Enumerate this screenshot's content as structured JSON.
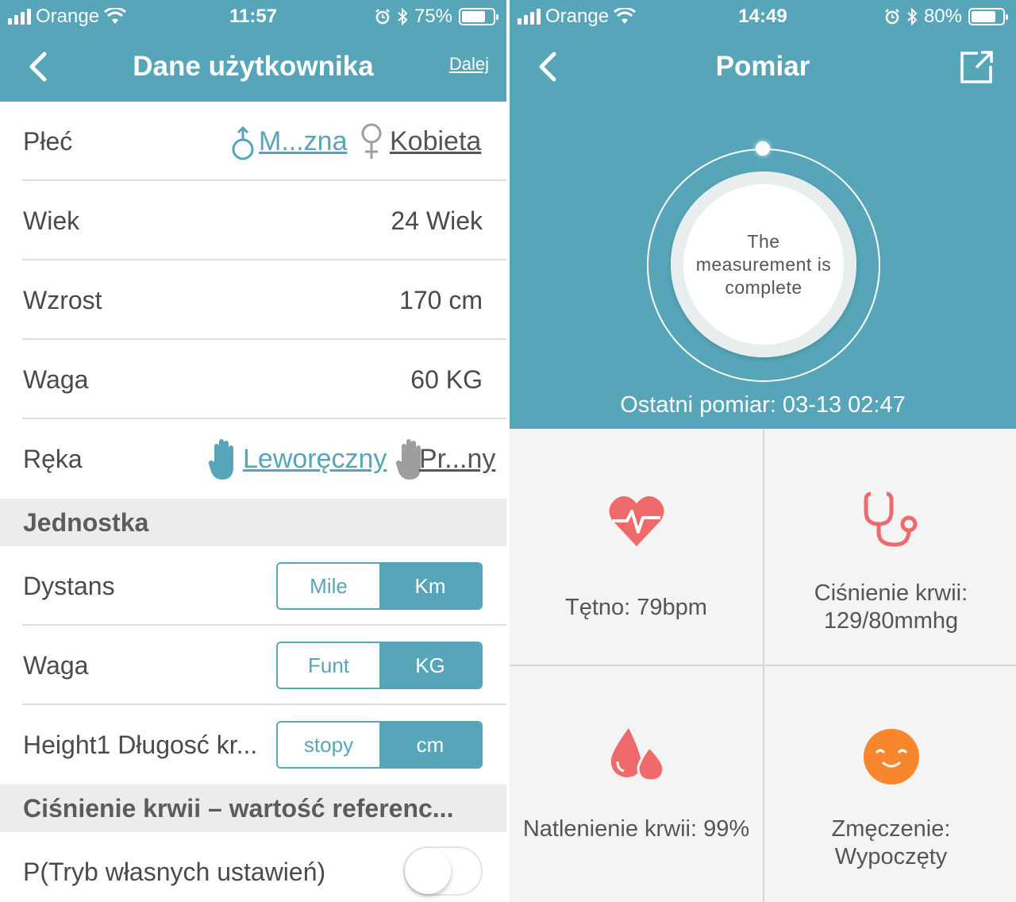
{
  "left": {
    "status": {
      "carrier": "Orange",
      "time": "11:57",
      "battery": "75%",
      "battery_level": 0.75
    },
    "header": {
      "title": "Dane użytkownika",
      "next": "Dalej"
    },
    "rows": {
      "gender": {
        "label": "Płeć",
        "male": "M...zna",
        "female": "Kobieta",
        "selected": "male"
      },
      "age": {
        "label": "Wiek",
        "value": "24 Wiek"
      },
      "height": {
        "label": "Wzrost",
        "value": "170 cm"
      },
      "weight": {
        "label": "Waga",
        "value": "60 KG"
      },
      "hand": {
        "label": "Ręka",
        "left": "Leworęczny",
        "right": "Pr...ny",
        "selected": "left"
      }
    },
    "units_section": "Jednostka",
    "units": [
      {
        "label": "Dystans",
        "opt_a": "Mile",
        "opt_b": "Km",
        "selected": "b"
      },
      {
        "label": "Waga",
        "opt_a": "Funt",
        "opt_b": "KG",
        "selected": "b"
      },
      {
        "label": "Height1 Długosć kr...",
        "opt_a": "stopy",
        "opt_b": "cm",
        "selected": "b"
      }
    ],
    "bp_section": "Ciśnienie krwii – wartość referenc...",
    "bp_row": {
      "label": "P(Tryb własnych ustawień)",
      "toggle_on": false
    },
    "colors": {
      "accent": "#56a5b8",
      "gray_icon": "#9e9e9e"
    }
  },
  "right": {
    "status": {
      "carrier": "Orange",
      "time": "14:49",
      "battery": "80%",
      "battery_level": 0.8
    },
    "header": {
      "title": "Pomiar"
    },
    "circle_text": "The measurement is complete",
    "last_measurement": "Ostatni pomiar: 03-13 02:47",
    "tiles": {
      "heart": {
        "label": "Tętno: 79bpm",
        "icon": "heart-pulse-icon"
      },
      "bp": {
        "label": "Ciśnienie krwii: 129/80mmhg",
        "icon": "stethoscope-icon"
      },
      "oxygen": {
        "label": "Natlenienie krwii: 99%",
        "icon": "blood-drops-icon"
      },
      "fatigue": {
        "label": "Zmęczenie: Wypoczęty",
        "icon": "smiley-icon"
      }
    },
    "colors": {
      "icon_red": "#ef6b6b",
      "icon_orange": "#f7862c"
    }
  }
}
